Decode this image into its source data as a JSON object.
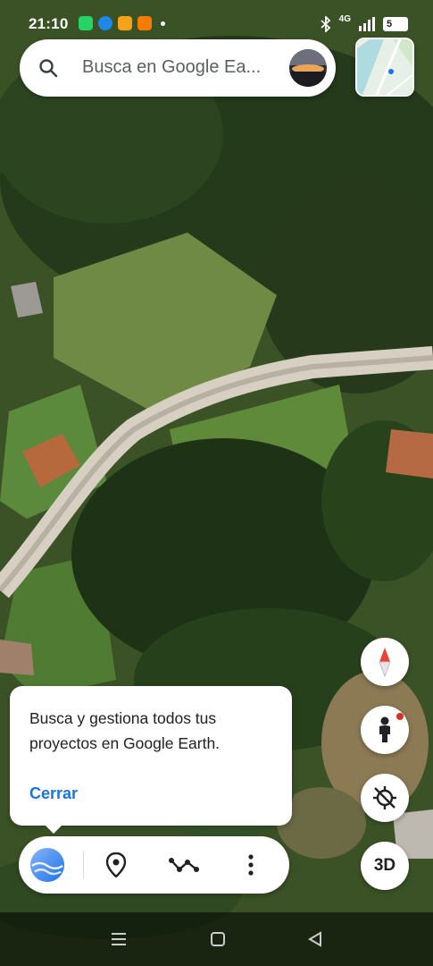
{
  "status_bar": {
    "time": "21:10",
    "network": "4G",
    "battery": "5",
    "app_icons": [
      "whatsapp-icon",
      "link-icon",
      "notification-icon",
      "notification-icon"
    ]
  },
  "search": {
    "placeholder": "Busca en Google Ea..."
  },
  "map_controls": {
    "three_d_label": "3D"
  },
  "tooltip": {
    "text": "Busca y gestiona todos tus proyectos en Google Earth.",
    "close_label": "Cerrar"
  },
  "toolbar": {
    "items": [
      "projects-icon",
      "place-icon",
      "measure-icon",
      "more-icon"
    ]
  },
  "colors": {
    "accent": "#1a73e8",
    "alert_dot": "#d93025",
    "compass_red": "#ea4335"
  }
}
